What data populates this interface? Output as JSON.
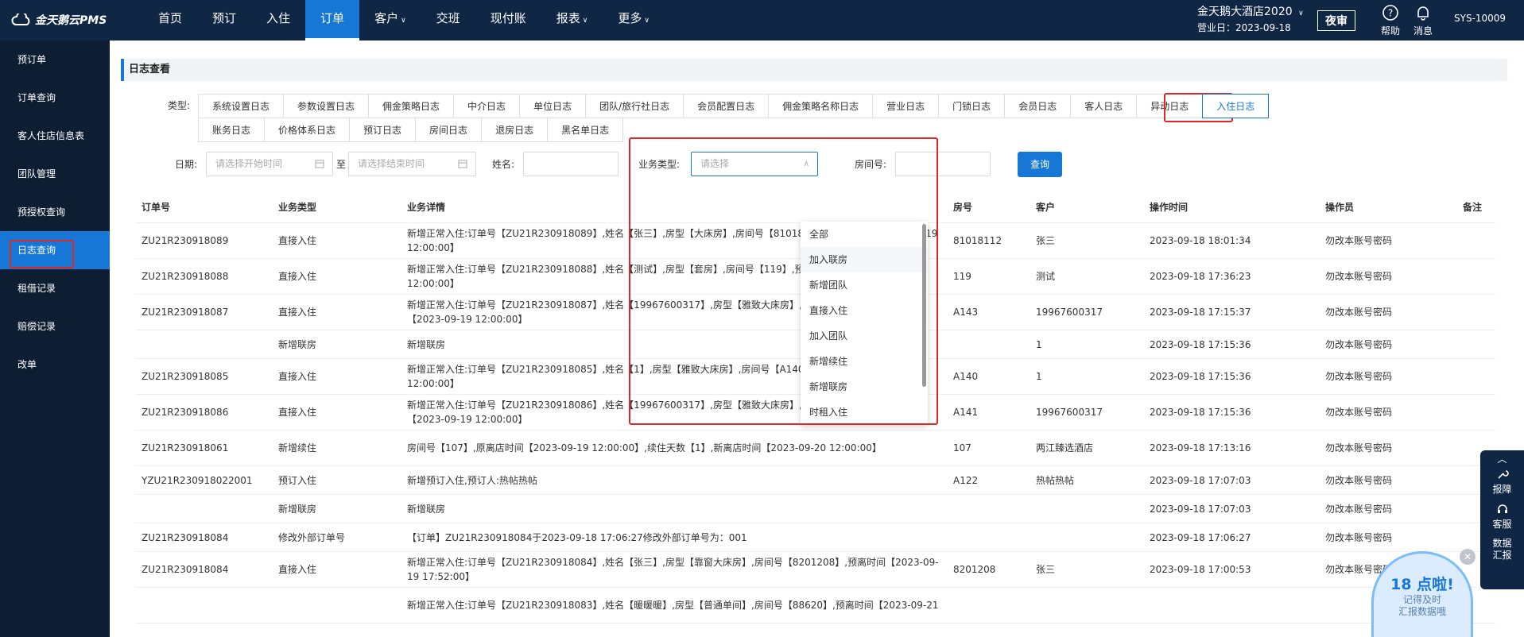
{
  "app": {
    "logo_text": "金天鹅云PMS"
  },
  "nav": {
    "items": [
      {
        "label": "首页",
        "caret": false,
        "active": false
      },
      {
        "label": "预订",
        "caret": false,
        "active": false
      },
      {
        "label": "入住",
        "caret": false,
        "active": false
      },
      {
        "label": "订单",
        "caret": false,
        "active": true
      },
      {
        "label": "客户",
        "caret": true,
        "active": false
      },
      {
        "label": "交班",
        "caret": false,
        "active": false
      },
      {
        "label": "现付账",
        "caret": false,
        "active": false
      },
      {
        "label": "报表",
        "caret": true,
        "active": false
      },
      {
        "label": "更多",
        "caret": true,
        "active": false
      }
    ]
  },
  "header": {
    "hotel_name": "金天鹅大酒店2020",
    "business_day": "营业日：2023-09-18",
    "night_audit": "夜审",
    "help": "帮助",
    "messages": "消息",
    "user": "SYS-10009"
  },
  "sidebar": {
    "items": [
      {
        "label": "预订单",
        "active": false
      },
      {
        "label": "订单查询",
        "active": false
      },
      {
        "label": "客人住店信息表",
        "active": false
      },
      {
        "label": "团队管理",
        "active": false
      },
      {
        "label": "预授权查询",
        "active": false
      },
      {
        "label": "日志查询",
        "active": true
      },
      {
        "label": "租借记录",
        "active": false
      },
      {
        "label": "赔偿记录",
        "active": false
      },
      {
        "label": "改单",
        "active": false
      }
    ]
  },
  "page": {
    "title": "日志查看"
  },
  "filters": {
    "type_label": "类型:",
    "types": [
      {
        "label": "系统设置日志",
        "active": false
      },
      {
        "label": "参数设置日志",
        "active": false
      },
      {
        "label": "佣金策略日志",
        "active": false
      },
      {
        "label": "中介日志",
        "active": false
      },
      {
        "label": "单位日志",
        "active": false
      },
      {
        "label": "团队/旅行社日志",
        "active": false
      },
      {
        "label": "会员配置日志",
        "active": false
      },
      {
        "label": "佣金策略名称日志",
        "active": false
      },
      {
        "label": "营业日志",
        "active": false
      },
      {
        "label": "门锁日志",
        "active": false
      },
      {
        "label": "会员日志",
        "active": false
      },
      {
        "label": "客人日志",
        "active": false
      },
      {
        "label": "异动日志",
        "active": false
      },
      {
        "label": "入住日志",
        "active": true
      },
      {
        "label": "账务日志",
        "active": false
      },
      {
        "label": "价格体系日志",
        "active": false
      },
      {
        "label": "预订日志",
        "active": false
      },
      {
        "label": "房间日志",
        "active": false
      },
      {
        "label": "退房日志",
        "active": false
      },
      {
        "label": "黑名单日志",
        "active": false
      }
    ],
    "date_label": "日期:",
    "start_placeholder": "请选择开始时间",
    "to": "至",
    "end_placeholder": "请选择结束时间",
    "name_label": "姓名:",
    "biz_type_label": "业务类型:",
    "biz_type_placeholder": "请选择",
    "room_label": "房间号:",
    "search": "查询"
  },
  "dropdown": {
    "options": [
      "全部",
      "加入联房",
      "新增团队",
      "直接入住",
      "加入团队",
      "新增续住",
      "新增联房",
      "时租入住"
    ]
  },
  "table": {
    "headers": [
      "订单号",
      "业务类型",
      "业务详情",
      "房号",
      "客户",
      "操作时间",
      "操作员",
      "备注"
    ],
    "rows": [
      [
        "ZU21R230918089",
        "直接入住",
        "新增正常入住:订单号【ZU21R230918089】,姓名【张三】,房型【大床房】,房间号【81018112】,预离时间【2023-09-19 12:00:00】",
        "81018112",
        "张三",
        "2023-09-18 18:01:34",
        "勿改本账号密码",
        ""
      ],
      [
        "ZU21R230918088",
        "直接入住",
        "新增正常入住:订单号【ZU21R230918088】,姓名【测试】,房型【套房】,房间号【119】,预离时间【2023-09-19 12:00:00】",
        "119",
        "测试",
        "2023-09-18 17:36:23",
        "勿改本账号密码",
        ""
      ],
      [
        "ZU21R230918087",
        "直接入住",
        "新增正常入住:订单号【ZU21R230918087】,姓名【19967600317】,房型【雅致大床房】,房间号【A143】,预离时间【2023-09-19 12:00:00】",
        "A143",
        "19967600317",
        "2023-09-18 17:15:37",
        "勿改本账号密码",
        ""
      ],
      [
        "",
        "新增联房",
        "新增联房",
        "",
        "1",
        "2023-09-18 17:15:36",
        "勿改本账号密码",
        ""
      ],
      [
        "ZU21R230918085",
        "直接入住",
        "新增正常入住:订单号【ZU21R230918085】,姓名【1】,房型【雅致大床房】,房间号【A140】,预离时间【2023-09-19 12:00:00】",
        "A140",
        "1",
        "2023-09-18 17:15:36",
        "勿改本账号密码",
        ""
      ],
      [
        "ZU21R230918086",
        "直接入住",
        "新增正常入住:订单号【ZU21R230918086】,姓名【19967600317】,房型【雅致大床房】,房间号【A141】,预离时间【2023-09-19 12:00:00】",
        "A141",
        "19967600317",
        "2023-09-18 17:15:36",
        "勿改本账号密码",
        ""
      ],
      [
        "ZU21R230918061",
        "新增续住",
        "房间号【107】,原离店时间【2023-09-19 12:00:00】,续住天数【1】,新离店时间【2023-09-20 12:00:00】",
        "107",
        "两江臻选酒店",
        "2023-09-18 17:13:16",
        "勿改本账号密码",
        ""
      ],
      [
        "YZU21R230918022001",
        "预订入住",
        "新增预订入住,预订人:热帖热帖",
        "A122",
        "热帖热帖",
        "2023-09-18 17:07:03",
        "勿改本账号密码",
        ""
      ],
      [
        "",
        "新增联房",
        "新增联房",
        "",
        "",
        "2023-09-18 17:07:03",
        "勿改本账号密码",
        ""
      ],
      [
        "ZU21R230918084",
        "修改外部订单号",
        "【订单】ZU21R230918084于2023-09-18 17:06:27修改外部订单号为：001",
        "",
        "",
        "2023-09-18 17:06:27",
        "勿改本账号密码",
        ""
      ],
      [
        "ZU21R230918084",
        "直接入住",
        "新增正常入住:订单号【ZU21R230918084】,姓名【张三】,房型【靠窗大床房】,房间号【8201208】,预离时间【2023-09-19 17:52:00】",
        "8201208",
        "张三",
        "2023-09-18 17:00:53",
        "勿改本账号密码",
        ""
      ],
      [
        "",
        "",
        "新增正常入住:订单号【ZU21R230918083】,姓名【暖暖暖】,房型【普通单间】,房间号【88620】,预离时间【2023-09-21",
        "",
        "",
        "",
        "",
        ""
      ]
    ]
  },
  "floating": {
    "items": [
      "报障",
      "客服",
      "数据汇报"
    ]
  },
  "popup": {
    "headline": "18 点啦!",
    "line1": "记得及时",
    "line2": "汇报数据哦"
  },
  "colors": {
    "primary": "#1677d6",
    "nav_bg": "#0f2644",
    "sidebar_bg": "#0d1e33",
    "highlight": "#e02626"
  }
}
